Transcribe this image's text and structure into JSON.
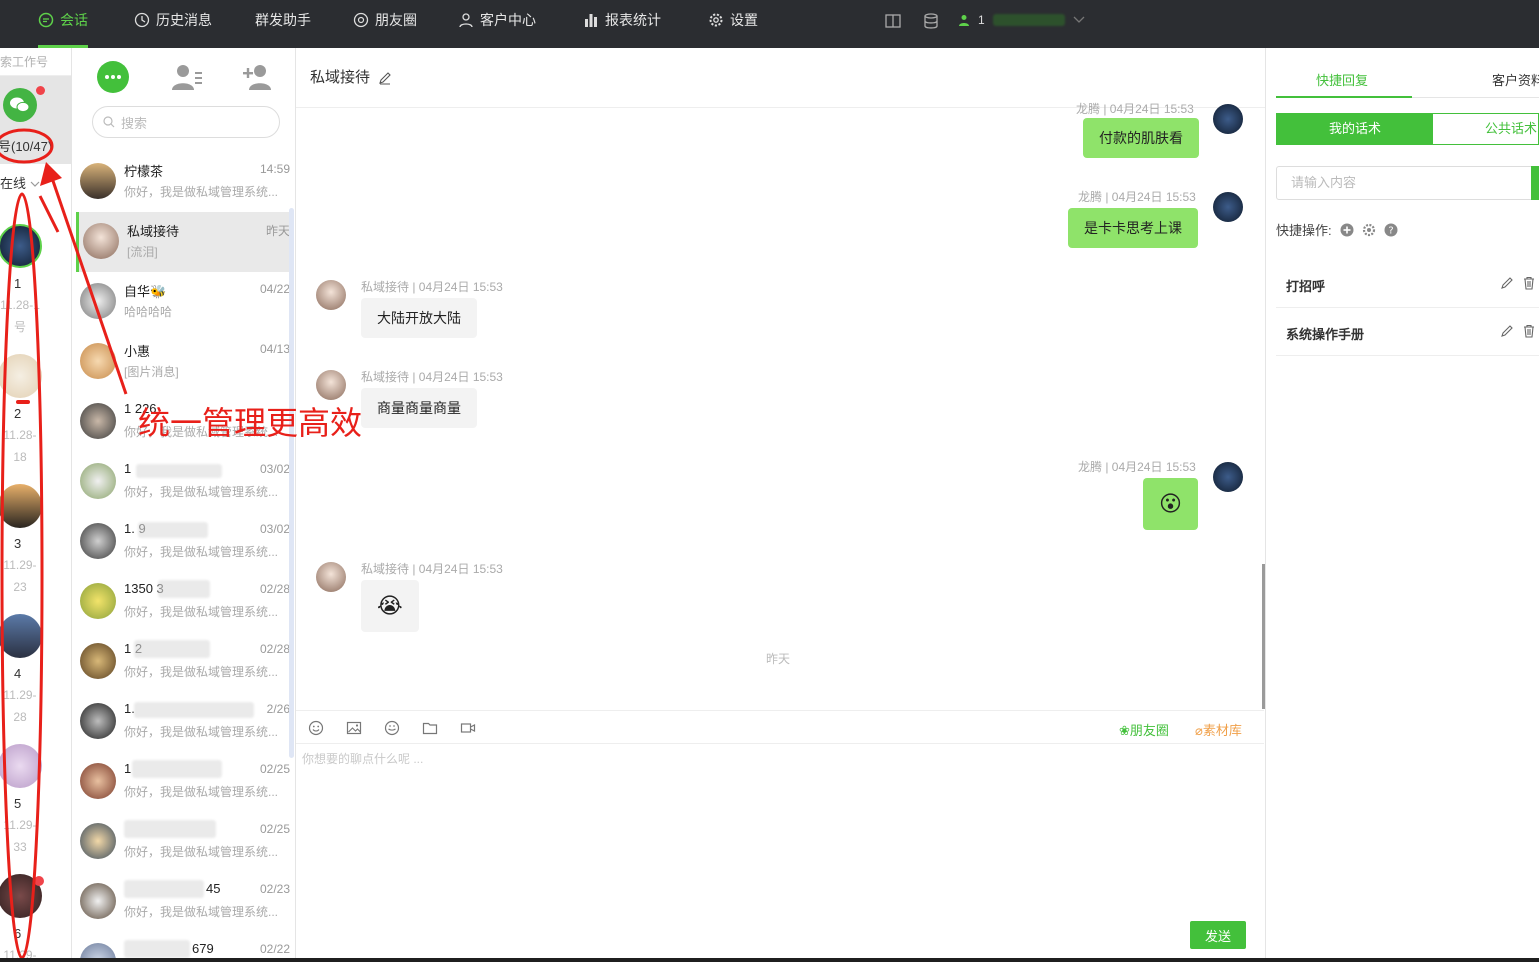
{
  "nav": {
    "items": [
      {
        "label": "会话",
        "icon": "chat-bubble-icon",
        "active": true
      },
      {
        "label": "历史消息",
        "icon": "clock-icon"
      },
      {
        "label": "群发助手",
        "icon": ""
      },
      {
        "label": "朋友圈",
        "icon": "camera-aperture-icon"
      },
      {
        "label": "客户中心",
        "icon": "person-icon"
      },
      {
        "label": "报表统计",
        "icon": "bar-chart-icon"
      },
      {
        "label": "设置",
        "icon": "gear-icon"
      }
    ],
    "user_prefix": "1"
  },
  "accounts": {
    "search_placeholder": "索工作号",
    "count_label": "号(10/47)",
    "status": "在线",
    "items": [
      {
        "num": "1",
        "date1": "11.28-1",
        "date2": "号"
      },
      {
        "num": "2",
        "date1": "11.28-",
        "date2": "18"
      },
      {
        "num": "3",
        "date1": "11.29-",
        "date2": "23"
      },
      {
        "num": "4",
        "date1": "11.29-",
        "date2": "28"
      },
      {
        "num": "5",
        "date1": "11.29-",
        "date2": "33"
      },
      {
        "num": "6",
        "date1": "11.29-",
        "date2": ""
      }
    ]
  },
  "conversations": {
    "search_placeholder": "搜索",
    "items": [
      {
        "name": "柠檬茶",
        "time": "14:59",
        "preview": "你好，我是做私域管理系统..."
      },
      {
        "name": "私域接待",
        "time": "昨天",
        "preview": "[流泪]",
        "selected": true
      },
      {
        "name": "自华🐝",
        "time": "04/22",
        "preview": "哈哈哈哈"
      },
      {
        "name": "小惠",
        "time": "04/13",
        "preview": "[图片消息]"
      },
      {
        "name": "1 226",
        "time": "",
        "preview": "你好，我是做私域管理系统..."
      },
      {
        "name": "1",
        "time": "03/02",
        "preview": "你好，我是做私域管理系统..."
      },
      {
        "name": "1. 9",
        "time": "03/02",
        "preview": "你好，我是做私域管理系统..."
      },
      {
        "name": "1350 3",
        "time": "02/28",
        "preview": "你好，我是做私域管理系统..."
      },
      {
        "name": "1 2",
        "time": "02/28",
        "preview": "你好，我是做私域管理系统..."
      },
      {
        "name": "1.",
        "time": "2/26",
        "preview": "你好，我是做私域管理系统..."
      },
      {
        "name": "1",
        "time": "02/25",
        "preview": "你好，我是做私域管理系统..."
      },
      {
        "name": "",
        "time": "02/25",
        "preview": "你好，我是做私域管理系统..."
      },
      {
        "name": "45",
        "time": "02/23",
        "preview": "你好，我是做私域管理系统..."
      },
      {
        "name": "679",
        "time": "02/22",
        "preview": ""
      }
    ]
  },
  "chat": {
    "title": "私域接待",
    "messages": [
      {
        "from": "me",
        "meta": "龙腾 | 04月24日 15:53",
        "text": "付款的肌肤看"
      },
      {
        "from": "me",
        "meta": "龙腾 | 04月24日 15:53",
        "text": "是卡卡思考上课"
      },
      {
        "from": "other",
        "meta": "私域接待 | 04月24日 15:53",
        "text": "大陆开放大陆"
      },
      {
        "from": "other",
        "meta": "私域接待 | 04月24日 15:53",
        "text": "商量商量商量"
      },
      {
        "from": "me",
        "meta": "龙腾 | 04月24日 15:53",
        "text": "😮"
      },
      {
        "from": "other",
        "meta": "私域接待 | 04月24日 15:53",
        "text": "😭"
      }
    ],
    "date_divider": "昨天",
    "toolbar": {
      "moments": "朋友圈",
      "library": "素材库"
    },
    "compose_placeholder": "你想要的聊点什么呢 ...",
    "send": "发送"
  },
  "right": {
    "tabs": [
      "快捷回复",
      "客户资料"
    ],
    "seg": [
      "我的话术",
      "公共话术"
    ],
    "input_placeholder": "请输入内容",
    "quick_ops_label": "快捷操作:",
    "items": [
      "打招呼",
      "系统操作手册"
    ]
  },
  "annotation": {
    "text": "统一管理更高效",
    "color": "#e8201a"
  },
  "colors": {
    "accent": "#43c03b",
    "topbar": "#2b2d31",
    "bubble_me": "#8fe36a"
  }
}
